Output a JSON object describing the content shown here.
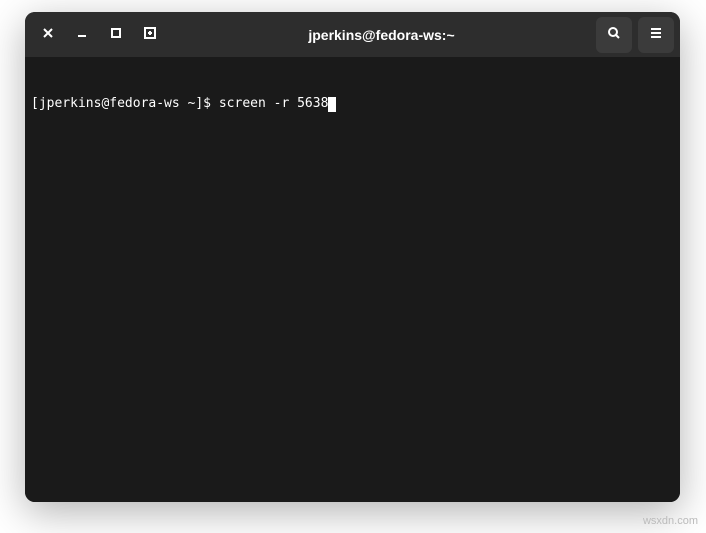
{
  "titlebar": {
    "title": "jperkins@fedora-ws:~",
    "close_icon": "close",
    "minimize_icon": "minimize",
    "maximize_icon": "maximize",
    "newtab_icon": "new-tab",
    "search_icon": "search",
    "menu_icon": "menu"
  },
  "terminal": {
    "prompt": "[jperkins@fedora-ws ~]$ ",
    "command": "screen -r 5638"
  },
  "watermark": "wsxdn.com"
}
